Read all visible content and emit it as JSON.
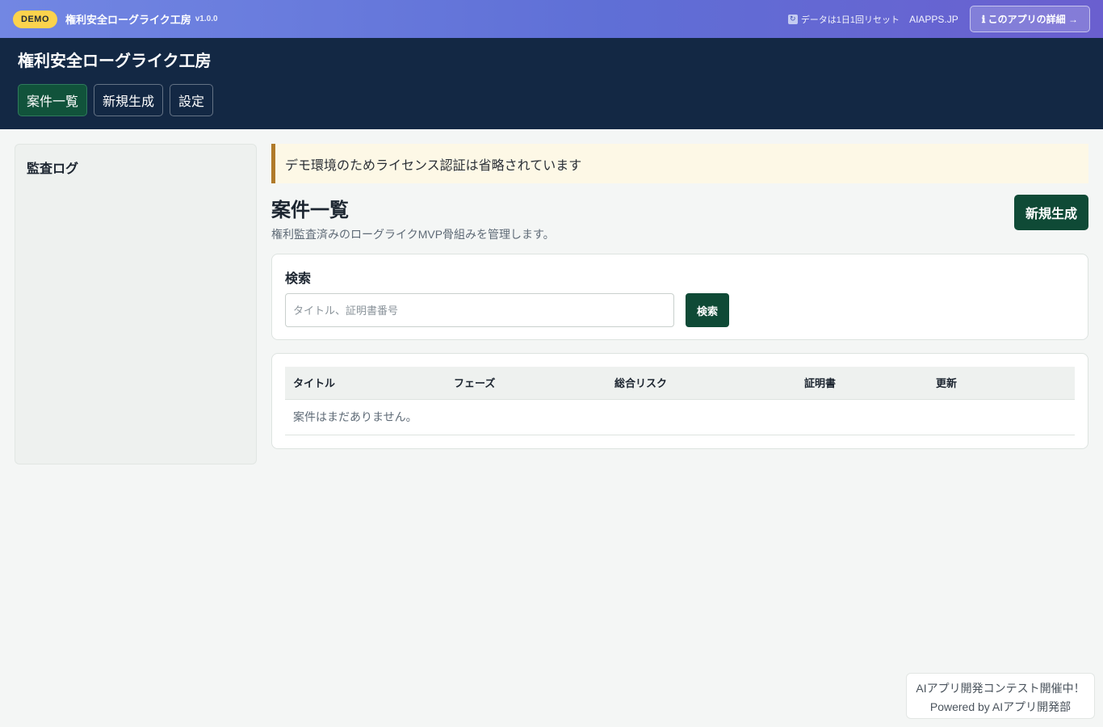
{
  "demo_bar": {
    "badge": "DEMO",
    "title": "権利安全ローグライク工房",
    "version": "v1.0.0",
    "reset_note": "データは1日1回リセット",
    "brand": "AIAPPS.JP",
    "about_label": "ℹ このアプリの詳細 →"
  },
  "header": {
    "title": "権利安全ローグライク工房",
    "nav": [
      {
        "label": "案件一覧"
      },
      {
        "label": "新規生成"
      },
      {
        "label": "設定"
      }
    ]
  },
  "sidebar": {
    "title": "監査ログ"
  },
  "notice": "デモ環境のためライセンス認証は省略されています",
  "page": {
    "title": "案件一覧",
    "description": "権利監査済みのローグライクMVP骨組みを管理します。",
    "create_label": "新規生成"
  },
  "search": {
    "label": "検索",
    "placeholder": "タイトル、証明書番号",
    "button_label": "検索"
  },
  "table": {
    "columns": [
      "タイトル",
      "フェーズ",
      "総合リスク",
      "証明書",
      "更新"
    ],
    "empty_message": "案件はまだありません。"
  },
  "promo": {
    "line1": "AIアプリ開発コンテスト開催中！",
    "line2": "Powered by AIアプリ開発部"
  }
}
